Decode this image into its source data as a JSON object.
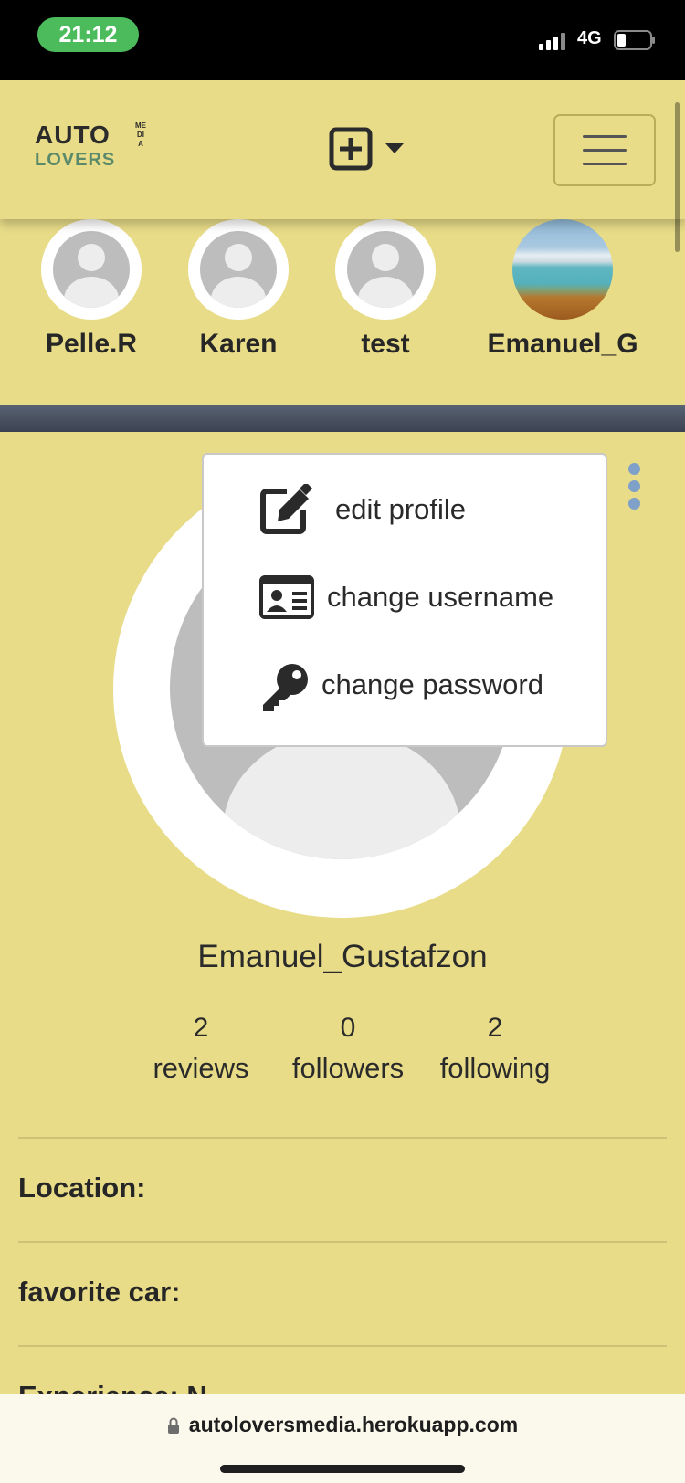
{
  "status_bar": {
    "time": "21:12",
    "network": "4G",
    "icons": [
      "signal-icon",
      "battery-icon"
    ]
  },
  "navbar": {
    "brand": {
      "line1": "AUTO",
      "line2": "LOVERS",
      "side": "MEDIA"
    },
    "add_icon": "plus-square-icon",
    "dropdown_icon": "caret-down-icon",
    "menu_icon": "hamburger-icon"
  },
  "following": [
    {
      "name": "Pelle.R",
      "avatar": "default-avatar"
    },
    {
      "name": "Karen",
      "avatar": "default-avatar"
    },
    {
      "name": "test",
      "avatar": "default-avatar"
    },
    {
      "name": "Emanuel_G",
      "avatar": "lake-photo"
    }
  ],
  "profile": {
    "username": "Emanuel_Gustafzon",
    "stats": [
      {
        "count": "2",
        "label": "reviews"
      },
      {
        "count": "0",
        "label": "followers"
      },
      {
        "count": "2",
        "label": "following"
      }
    ],
    "fields": [
      {
        "label": "Location:"
      },
      {
        "label": "favorite car:"
      },
      {
        "label": "Experience: N"
      }
    ]
  },
  "dropdown": {
    "items": [
      {
        "label": "edit profile",
        "icon": "edit-icon"
      },
      {
        "label": "change username",
        "icon": "id-card-icon"
      },
      {
        "label": "change password",
        "icon": "key-icon"
      }
    ]
  },
  "browser": {
    "url": "autoloversmedia.herokuapp.com",
    "lock_icon": "lock-icon"
  },
  "colors": {
    "page_bg": "#e8dc88",
    "time_pill": "#4cbb5b",
    "kebab": "#7fa0c8",
    "divider": "#3b4352"
  }
}
